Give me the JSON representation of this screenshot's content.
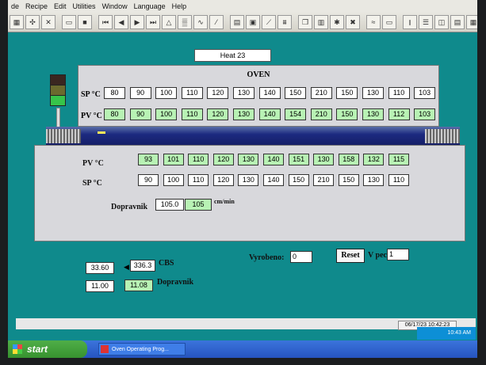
{
  "menu": [
    "de",
    "Recipe",
    "Edit",
    "Utilities",
    "Window",
    "Language",
    "Help"
  ],
  "heat_label": "Heat 23",
  "oven": {
    "title": "OVEN",
    "sp_label": "SP °C",
    "pv_label": "PV °C",
    "sp": [
      "80",
      "90",
      "100",
      "110",
      "120",
      "130",
      "140",
      "150",
      "210",
      "150",
      "130",
      "110",
      "103"
    ],
    "pv": [
      "80",
      "90",
      "100",
      "110",
      "120",
      "130",
      "140",
      "154",
      "210",
      "150",
      "130",
      "112",
      "103"
    ]
  },
  "lower": {
    "pv_label": "PV °C",
    "sp_label": "SP °C",
    "pv": [
      "93",
      "101",
      "110",
      "120",
      "130",
      "140",
      "151",
      "130",
      "158",
      "132",
      "115"
    ],
    "sp": [
      "90",
      "100",
      "110",
      "120",
      "130",
      "140",
      "150",
      "210",
      "150",
      "130",
      "110"
    ],
    "dopravnik_label": "Dopravnik",
    "dopravnik_sp": "105.0",
    "dopravnik_pv": "105",
    "unit": "cm/min"
  },
  "bottom": {
    "cbs_left": "33.60",
    "cbs_right": "336.3",
    "cbs_label": "CBS",
    "dop_left": "11.00",
    "dop_right": "11.08",
    "dop_label": "Dopravnik",
    "vyrobeno_label": "Vyrobeno:",
    "vyrobeno_value": "0",
    "reset_label": "Reset",
    "vpeci_label": "V peci:",
    "vpeci_value": "1"
  },
  "status_datetime": "06/17/23  10:42:23",
  "taskbar": {
    "start": "start",
    "task": "Oven Operating Prog...",
    "clock": "10:43 AM"
  },
  "colors": {
    "background": "#0f8a8c",
    "pv_cell": "#b8f2b4",
    "panel": "#d8d8dc"
  }
}
